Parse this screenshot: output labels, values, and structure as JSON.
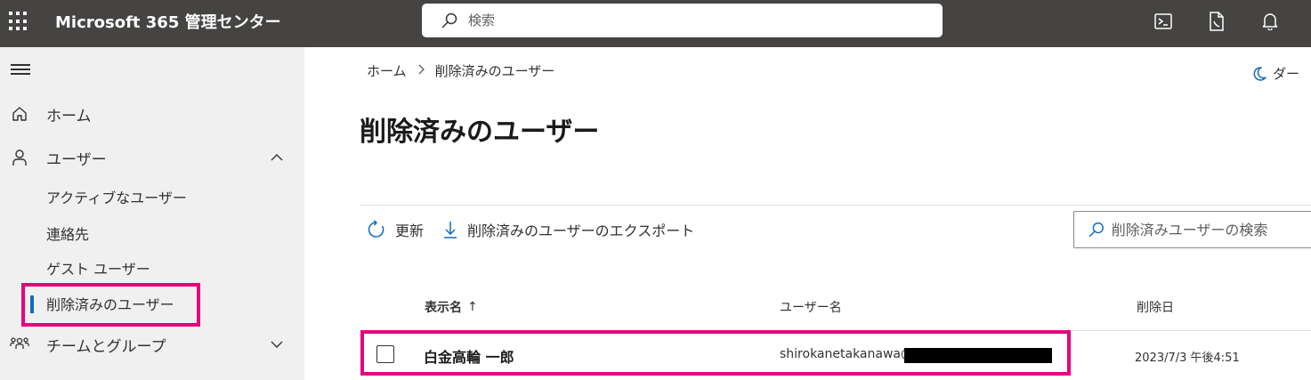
{
  "topbar": {
    "app_title": "Microsoft 365 管理センター",
    "search_placeholder": "検索",
    "icons": [
      "waffle-icon",
      "terminal-icon",
      "document-phone-icon",
      "bell-icon"
    ]
  },
  "sidebar": {
    "items": [
      {
        "label": "ホーム",
        "icon": "home-icon"
      },
      {
        "label": "ユーザー",
        "icon": "person-icon",
        "expanded": true
      },
      {
        "label": "チームとグループ",
        "icon": "people-team-icon",
        "expanded": false
      }
    ],
    "sub_items": [
      {
        "label": "アクティブなユーザー"
      },
      {
        "label": "連絡先"
      },
      {
        "label": "ゲスト ユーザー"
      },
      {
        "label": "削除済みのユーザー",
        "active": true
      }
    ]
  },
  "main": {
    "breadcrumb": [
      "ホーム",
      "削除済みのユーザー"
    ],
    "dark_mode_label": "ダー",
    "page_title": "削除済みのユーザー",
    "commands": {
      "refresh": "更新",
      "export": "削除済みのユーザーのエクスポート"
    },
    "list_search_placeholder": "削除済みユーザーの検索",
    "columns": {
      "display_name": "表示名",
      "sort_indicator": "↑",
      "user_name": "ユーザー名",
      "deleted_date": "削除日"
    },
    "rows": [
      {
        "display_name": "白金高輪 一郎",
        "user_name": "shirokanetakanawa@",
        "deleted_date": "2023/7/3 午後4:51"
      }
    ]
  },
  "colors": {
    "topbar_bg": "#454442",
    "sidebar_bg": "#f0f0f0",
    "accent": "#0f6cbd",
    "highlight": "#e6007e"
  }
}
